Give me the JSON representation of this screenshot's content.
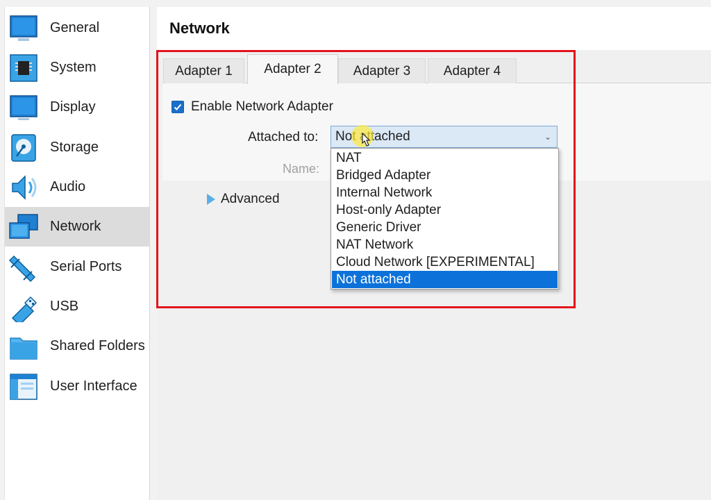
{
  "sidebar": {
    "items": [
      {
        "label": "General",
        "icon": "general-icon"
      },
      {
        "label": "System",
        "icon": "system-icon"
      },
      {
        "label": "Display",
        "icon": "display-icon"
      },
      {
        "label": "Storage",
        "icon": "storage-icon"
      },
      {
        "label": "Audio",
        "icon": "audio-icon"
      },
      {
        "label": "Network",
        "icon": "network-icon",
        "selected": true
      },
      {
        "label": "Serial Ports",
        "icon": "serial-ports-icon"
      },
      {
        "label": "USB",
        "icon": "usb-icon"
      },
      {
        "label": "Shared Folders",
        "icon": "shared-folders-icon"
      },
      {
        "label": "User Interface",
        "icon": "user-interface-icon"
      }
    ]
  },
  "page": {
    "title": "Network"
  },
  "tabs": [
    {
      "label": "Adapter 1"
    },
    {
      "label": "Adapter 2",
      "active": true
    },
    {
      "label": "Adapter 3"
    },
    {
      "label": "Adapter 4"
    }
  ],
  "adapter": {
    "enable_label": "Enable Network Adapter",
    "enabled": true,
    "attached_label": "Attached to:",
    "attached_value": "Not attached",
    "name_label": "Name:",
    "advanced_label": "Advanced"
  },
  "dropdown": {
    "options": [
      "NAT",
      "Bridged Adapter",
      "Internal Network",
      "Host-only Adapter",
      "Generic Driver",
      "NAT Network",
      "Cloud Network [EXPERIMENTAL]",
      "Not attached"
    ],
    "selected_index": 7
  },
  "colors": {
    "highlight": "#e3141b",
    "selection": "#0c72d9",
    "icon_blue": "#1f8ad4"
  }
}
